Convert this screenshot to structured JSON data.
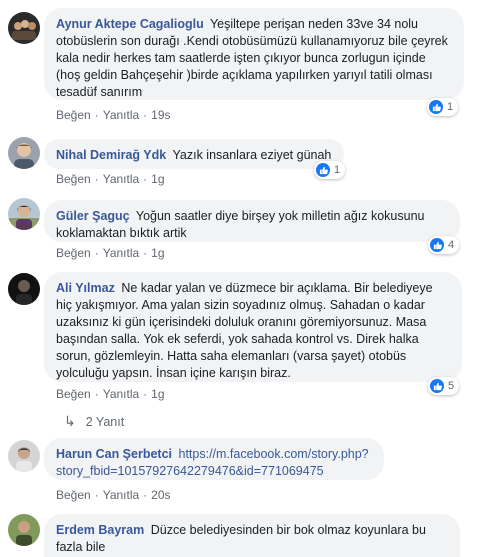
{
  "colors": {
    "author": "#385898",
    "bubble": "#f2f3f5",
    "meta": "#606770",
    "like": "#1877f2"
  },
  "actions": {
    "like": "Beğen",
    "reply": "Yanıtla",
    "sep": "·"
  },
  "comments": [
    {
      "author": "Aynur Aktepe Cagalioglu",
      "text": "Yeşiltepe perişan neden 33ve 34 nolu otobüslerin son durağı .Kendi otobüsümüzü kullanamıyoruz bile çeyrek kala nedir herkes tam saatlerde işten çıkıyor bunca zorlugun içinde (hoş geldin Bahçeşehir )birde açıklama yapılırken yarıyıl tatili olması tesadüf sanırım",
      "time": "19s",
      "likes": "1",
      "avatar": "group-photo-icon"
    },
    {
      "author": "Nihal Demirağ Ydk",
      "text": "Yazık insanlara eziyet günah",
      "time": "1g",
      "likes": "1",
      "avatar": "woman-photo-icon"
    },
    {
      "author": "Güler Şaguç",
      "text": "Yoğun saatler diye birşey yok milletin ağız kokusunu koklamaktan bıktık artik",
      "time": "1g",
      "likes": "4",
      "avatar": "woman-outdoor-photo-icon"
    },
    {
      "author": "Ali Yılmaz",
      "text": "Ne kadar yalan ve düzmece bir açıklama. Bir belediyeye hiç yakışmıyor. Ama yalan sizin soyadınız olmuş. Sahadan o kadar uzaksınız ki gün içerisindeki doluluk oranını göremiyorsunuz. Masa başından salla. Yok ek seferdi, yok sahada kontrol vs. Direk halka sorun, gözlemleyin. Hatta saha elemanları (varsa şayet) otobüs yolculuğu yapsın. İnsan içine karışın biraz.",
      "time": "1g",
      "likes": "5",
      "replies": "2 Yanıt",
      "avatar": "man-dark-photo-icon"
    },
    {
      "author": "Harun Can Şerbetci",
      "link": "https://m.facebook.com/story.php?story_fbid=10157927642279476&id=771069475",
      "time": "20s",
      "avatar": "man-photo-icon"
    },
    {
      "author": "Erdem Bayram",
      "text": "Düzce belediyesinden bir bok olmaz koyunlara bu fazla bile",
      "avatar": "man-field-photo-icon"
    }
  ]
}
